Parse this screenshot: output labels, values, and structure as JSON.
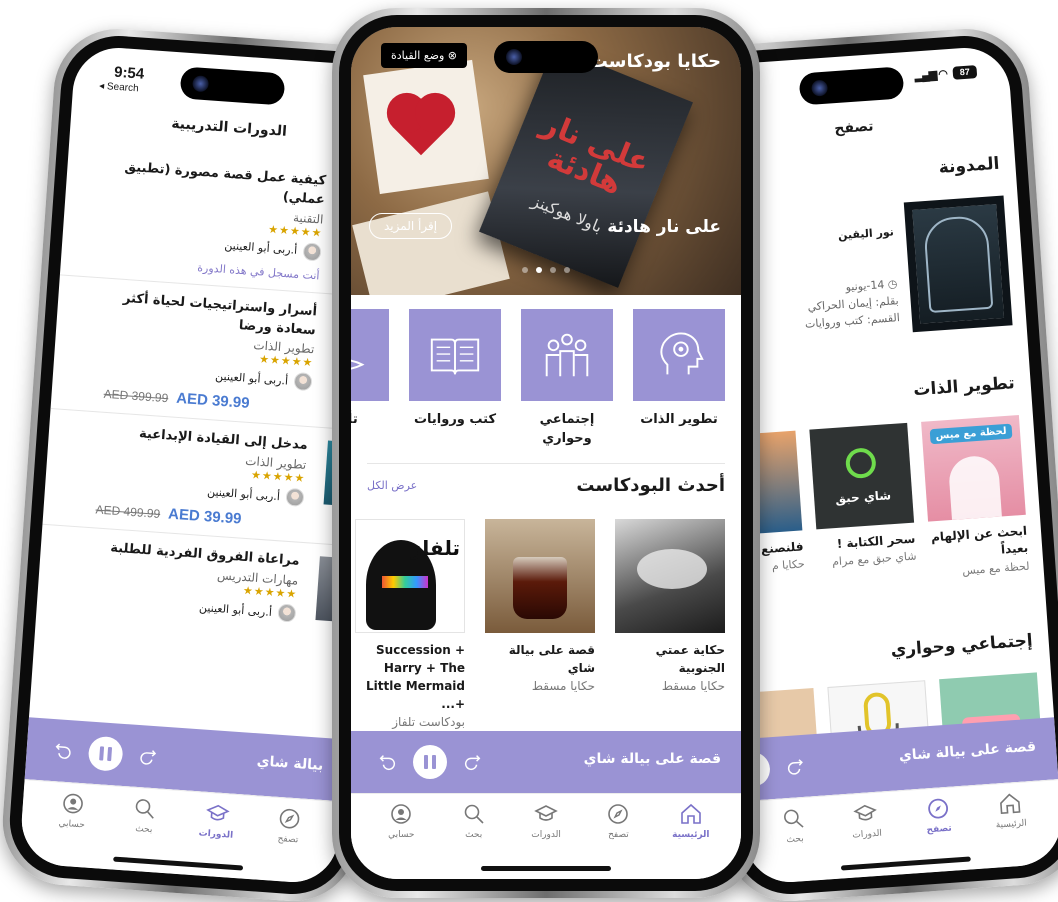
{
  "left_phone": {
    "status": {
      "time": "9:54",
      "back": "◂ Search"
    },
    "title": "الدورات التدريبية",
    "courses": [
      {
        "title": "كيفية عمل قصة مصورة (تطبيق عملي)",
        "category": "التقنية",
        "rating": "★★★★★",
        "instructor": "أ.ربى أبو العينين",
        "enrolled": "أنت مسجل في هذه الدورة"
      },
      {
        "title": "أسرار واستراتيجيات لحياة أكثر سعادة ورضا",
        "category": "تطوير الذات",
        "rating": "★★★★★",
        "instructor": "أ.ربى أبو العينين",
        "price": "AED 39.99",
        "old_price": "AED 399.99"
      },
      {
        "title": "مدخل إلى القيادة الإبداعية",
        "category": "تطوير الذات",
        "rating": "★★★★★",
        "instructor": "أ.ربى أبو العينين",
        "price": "AED 39.99",
        "old_price": "AED 499.99"
      },
      {
        "title": "مراعاة الفروق الفردية للطلبة",
        "category": "مهارات التدريس",
        "rating": "★★★★★",
        "instructor": "أ.ربى أبو العينين"
      }
    ],
    "player_title": "بيالة شاي",
    "tabs": [
      {
        "label": "تصفح",
        "icon": "compass-icon"
      },
      {
        "label": "الدورات",
        "icon": "graduation-cap-icon",
        "active": true
      },
      {
        "label": "بحث",
        "icon": "search-icon"
      },
      {
        "label": "حسابي",
        "icon": "user-icon"
      }
    ]
  },
  "center_phone": {
    "driving_mode": "وضع القيادة",
    "header_title": "حكايا بودكاست",
    "hero": {
      "title": "على نار هادئة",
      "read_more": "إقرأ المزيد",
      "book_title": "على نار هادئة",
      "book_author": "باولا هوكينز",
      "slides": 4,
      "active_slide": 2
    },
    "categories": [
      {
        "label": "تطوير الذات",
        "icon": "head-gear-icon"
      },
      {
        "label": "إجتماعي وحواري",
        "icon": "people-icon"
      },
      {
        "label": "كتب وروايات",
        "icon": "open-book-icon"
      },
      {
        "label": "تأمل",
        "icon": "meditation-icon"
      }
    ],
    "latest": {
      "title": "أحدث البودكاست",
      "see_all": "عرض الكل",
      "items": [
        {
          "title": "حكاية عمتي الجنوبية",
          "subtitle": "حكايا مسقط"
        },
        {
          "title": "قصة على بيالة شاي",
          "subtitle": "حكايا مسقط"
        },
        {
          "title": "Succession + Harry + The Little Mermaid +...",
          "subtitle": "بودكاست تلفاز",
          "art_text": "تلفاز"
        }
      ]
    },
    "player_title": "قصة على بيالة شاي",
    "tabs": [
      {
        "label": "الرئيسية",
        "icon": "home-icon",
        "active": true
      },
      {
        "label": "تصفح",
        "icon": "compass-icon"
      },
      {
        "label": "الدورات",
        "icon": "graduation-cap-icon"
      },
      {
        "label": "بحث",
        "icon": "search-icon"
      },
      {
        "label": "حسابي",
        "icon": "user-icon"
      }
    ]
  },
  "right_phone": {
    "status": {
      "battery": "87"
    },
    "title": "تصفح",
    "blog": {
      "section": "المدونة",
      "title": "نور اليقين",
      "date": "14-يونيو",
      "author": "بقلم: إيمان الحراكي",
      "category": "القسم: كتب وروايات"
    },
    "self_dev": {
      "section": "تطوير الذات",
      "items": [
        {
          "title": "ابحث عن الإلهام بعيداً",
          "subtitle": "لحظة مع ميس",
          "art_text": "لحظة مع ميس"
        },
        {
          "title": "سحر الكتابة !",
          "subtitle": "شاي حبق مع مرام",
          "art_text": "شاي حبق"
        },
        {
          "title": "فلنصنع",
          "subtitle": "حكايا م"
        }
      ]
    },
    "social": {
      "section": "إجتماعي وحواري"
    },
    "player_title": "قصة على بيالة شاي",
    "tabs": [
      {
        "label": "الرئيسية",
        "icon": "home-icon"
      },
      {
        "label": "تصفح",
        "icon": "compass-icon",
        "active": true
      },
      {
        "label": "الدورات",
        "icon": "graduation-cap-icon"
      },
      {
        "label": "بحث",
        "icon": "search-icon"
      }
    ]
  },
  "colors": {
    "accent": "#9a93d4",
    "accent_dark": "#7a71c8",
    "price": "#4a7bd1",
    "stars": "#d9a400"
  }
}
